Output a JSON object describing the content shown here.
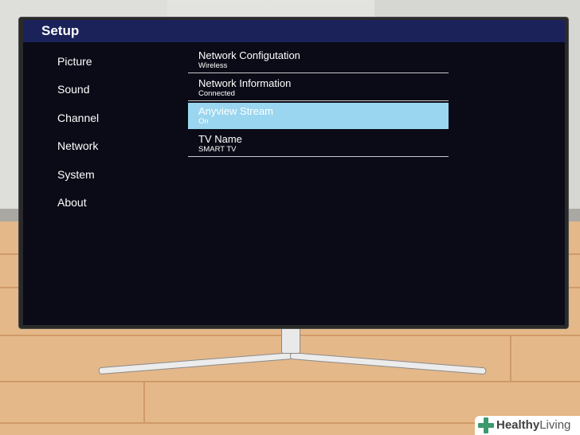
{
  "header": {
    "title": "Setup"
  },
  "left_menu": {
    "items": [
      {
        "label": "Picture"
      },
      {
        "label": "Sound"
      },
      {
        "label": "Channel"
      },
      {
        "label": "Network"
      },
      {
        "label": "System"
      },
      {
        "label": "About"
      }
    ]
  },
  "right_menu": {
    "items": [
      {
        "title": "Network Configutation",
        "value": "Wireless"
      },
      {
        "title": "Network Information",
        "value": "Connected"
      },
      {
        "title": "Anyview Stream",
        "value": "On",
        "selected": true
      },
      {
        "title": "TV Name",
        "value": "SMART TV"
      }
    ]
  },
  "watermark": {
    "brand_bold": "Healthy",
    "brand_light": "Living"
  },
  "colors": {
    "header_bar": "#1a2259",
    "screen_bg": "#0a0b16",
    "selected_bg": "#9ad6ef",
    "logo_green": "#3b9a6b"
  },
  "icons": {
    "logo": "plus-cross-icon"
  }
}
